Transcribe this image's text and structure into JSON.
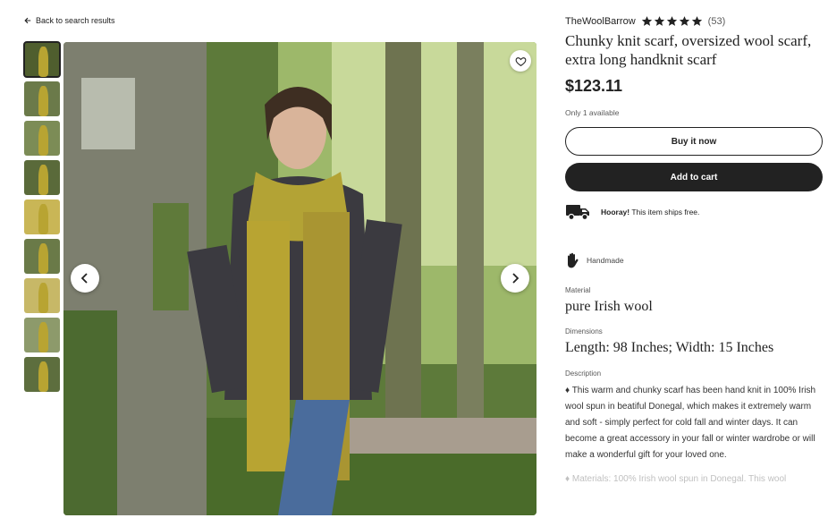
{
  "nav": {
    "back_label": "Back to search results"
  },
  "gallery": {
    "thumbnails": [
      {
        "bg": "#4f5e2e",
        "active": true
      },
      {
        "bg": "#6b7a4a"
      },
      {
        "bg": "#7c8c56"
      },
      {
        "bg": "#5a6a3a"
      },
      {
        "bg": "#c9b656"
      },
      {
        "bg": "#6a7a48"
      },
      {
        "bg": "#c7b867"
      },
      {
        "bg": "#8d9a6b"
      },
      {
        "bg": "#5d6e3e"
      }
    ]
  },
  "listing": {
    "shop_name": "TheWoolBarrow",
    "rating_stars": 5,
    "review_count": "(53)",
    "title": "Chunky knit scarf, oversized wool scarf, extra long handknit scarf",
    "price": "$123.11",
    "stock": "Only 1 available",
    "buy_now_label": "Buy it now",
    "add_to_cart_label": "Add to cart",
    "shipping_bold": "Hooray!",
    "shipping_text": " This item ships free.",
    "handmade_label": "Handmade",
    "material_label": "Material",
    "material_value": "pure Irish wool",
    "dimensions_label": "Dimensions",
    "dimensions_value": "Length: 98 Inches; Width: 15 Inches",
    "description_label": "Description",
    "description": "♦ This warm and chunky scarf has been hand knit in 100% Irish wool spun in beatiful Donegal, which makes it extremely warm and soft - simply perfect for cold fall and winter days. It can become a great accessory in your fall or winter wardrobe or will make a wonderful gift for your loved one.",
    "description_more": "♦ Materials: 100% Irish wool spun in Donegal. This wool"
  },
  "colors": {
    "primary": "#222222",
    "muted": "#595959",
    "scarf": "#b8a432"
  }
}
